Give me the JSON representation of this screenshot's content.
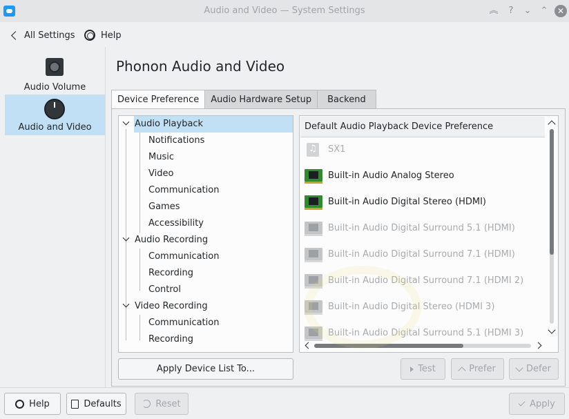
{
  "window": {
    "title": "Audio and Video  — System Settings"
  },
  "nav": {
    "back_label": "All Settings",
    "help_label": "Help"
  },
  "sidebar": {
    "items": [
      {
        "label": "Audio Volume",
        "icon": "speaker-icon"
      },
      {
        "label": "Audio and Video",
        "icon": "knob-icon"
      }
    ]
  },
  "page": {
    "title": "Phonon Audio and Video"
  },
  "tabs": [
    {
      "label": "Device Preference"
    },
    {
      "label": "Audio Hardware Setup"
    },
    {
      "label": "Backend"
    }
  ],
  "tree": {
    "audio_playback": {
      "label": "Audio Playback",
      "children": [
        "Notifications",
        "Music",
        "Video",
        "Communication",
        "Games",
        "Accessibility"
      ]
    },
    "audio_recording": {
      "label": "Audio Recording",
      "children": [
        "Communication",
        "Recording",
        "Control"
      ]
    },
    "video_recording": {
      "label": "Video Recording",
      "children": [
        "Communication",
        "Recording"
      ]
    }
  },
  "apply_list_button": "Apply Device List To...",
  "device_list": {
    "header": "Default Audio Playback Device Preference",
    "devices": [
      {
        "name": "SX1"
      },
      {
        "name": "Built-in Audio Analog Stereo"
      },
      {
        "name": "Built-in Audio Digital Stereo (HDMI)"
      },
      {
        "name": "Built-in Audio Digital Surround 5.1 (HDMI)"
      },
      {
        "name": "Built-in Audio Digital Surround 7.1 (HDMI)"
      },
      {
        "name": "Built-in Audio Digital Surround 7.1 (HDMI 2)"
      },
      {
        "name": "Built-in Audio Digital Stereo (HDMI 3)"
      },
      {
        "name": "Built-in Audio Digital Surround 5.1 (HDMI 3)"
      }
    ]
  },
  "actions": {
    "test": "Test",
    "prefer": "Prefer",
    "defer": "Defer"
  },
  "footer": {
    "help": "Help",
    "defaults": "Defaults",
    "reset": "Reset",
    "apply": "Apply"
  },
  "colors": {
    "selection": "#c2e0f5",
    "window_bg": "#eff0f1",
    "card_green": "#2e8b2e"
  }
}
